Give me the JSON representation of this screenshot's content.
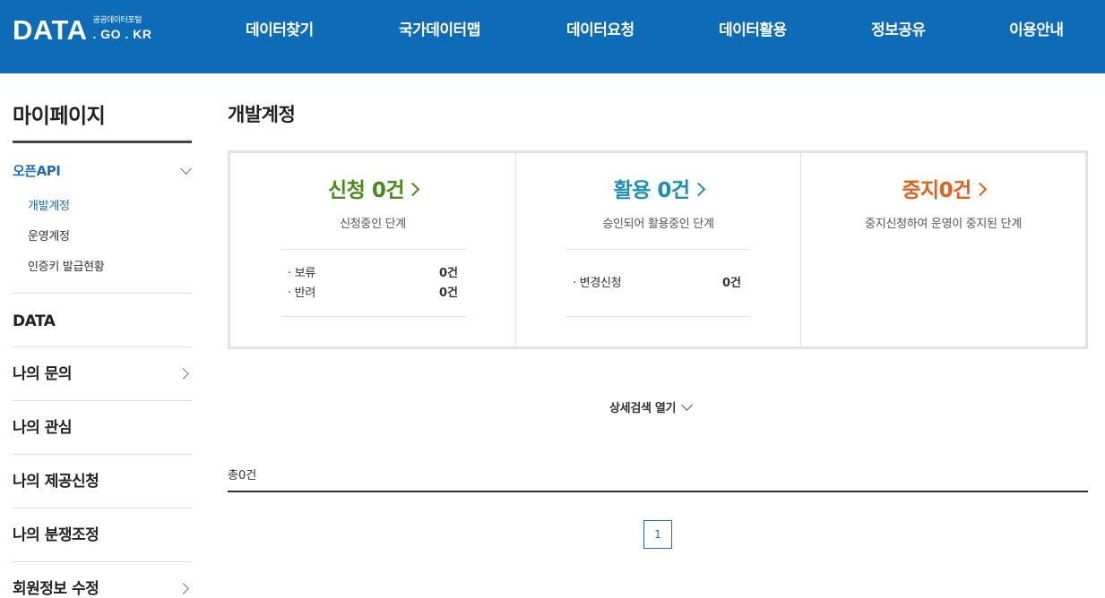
{
  "header": {
    "logo_main": "DATA",
    "logo_sub_top": "공공데이터포털",
    "logo_sub_bottom": ". GO . KR",
    "nav": [
      "데이터찾기",
      "국가데이터맵",
      "데이터요청",
      "데이터활용",
      "정보공유",
      "이용안내"
    ]
  },
  "sidebar": {
    "title": "마이페이지",
    "open_section": "오픈API",
    "sub_items": [
      "개발계정",
      "운영계정",
      "인증키 발급현황"
    ],
    "items": [
      "DATA",
      "나의 문의",
      "나의 관심",
      "나의 제공신청",
      "나의 분쟁조정",
      "회원정보 수정"
    ]
  },
  "main": {
    "title": "개발계정",
    "status": [
      {
        "title": "신청 0건",
        "desc": "신청중인 단계",
        "color": "#4a8a1c",
        "details": [
          {
            "label": "· 보류",
            "value": "0건"
          },
          {
            "label": "· 반려",
            "value": "0건"
          }
        ]
      },
      {
        "title": "활용 0건",
        "desc": "승인되어 활용중인 단계",
        "color": "#1a8fb5",
        "details": [
          {
            "label": "· 변경신청",
            "value": "0건"
          }
        ]
      },
      {
        "title": "중지0건",
        "desc": "중지신청하여 운영이 중지된 단계",
        "color": "#e0621c",
        "details": []
      }
    ],
    "detail_search": "상세검색 열기",
    "total": "총0건",
    "page": "1"
  },
  "colors": {
    "header_bg": "#0d6bb8",
    "accent": "#1f6db5"
  }
}
